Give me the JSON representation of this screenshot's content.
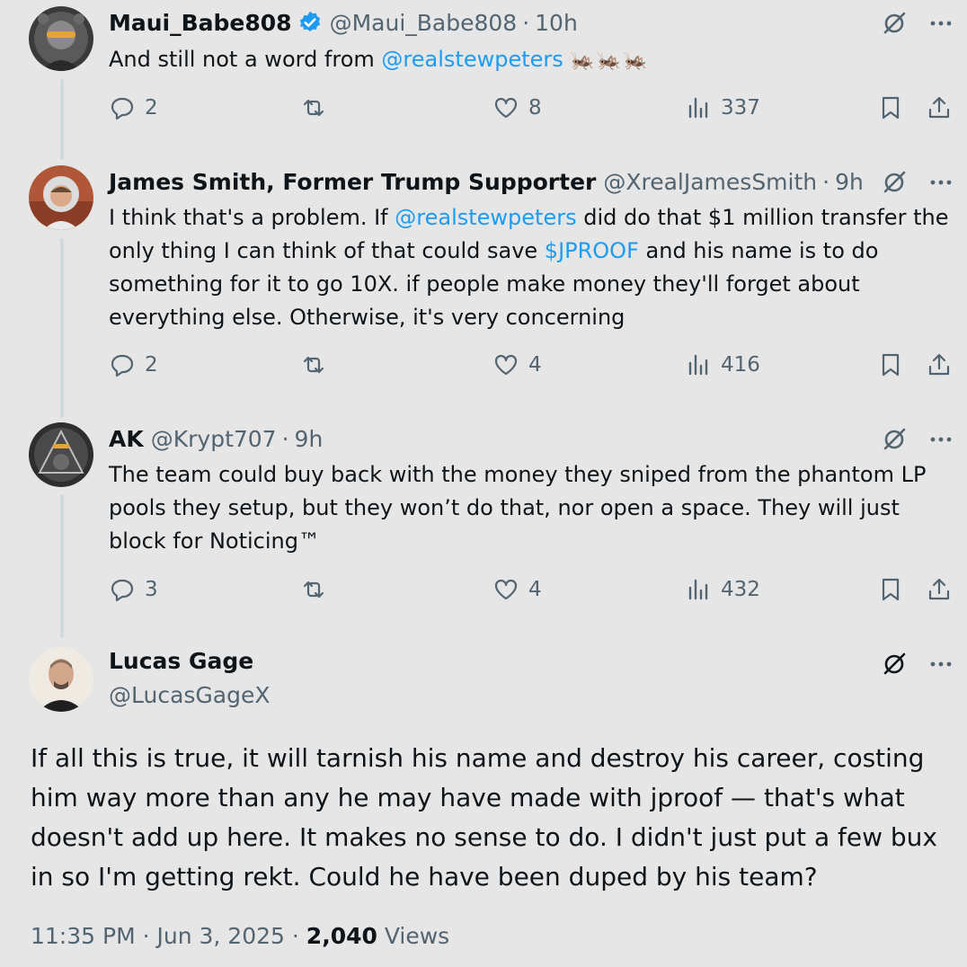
{
  "tweets": [
    {
      "name": "Maui_Babe808",
      "handle": "@Maui_Babe808",
      "sep": "·",
      "time": "10h",
      "verified": true,
      "text_pre": "And still not a word from ",
      "mention1": "@realstewpeters",
      "emoji": "🦗🦗🦗",
      "replies": "2",
      "likes": "8",
      "views": "337"
    },
    {
      "name": "James Smith, Former Trump Supporter",
      "handle": "@XrealJamesSmith",
      "sep": "·",
      "time": "9h",
      "text_a": "I think that's a problem. If ",
      "mention1": "@realstewpeters",
      "text_b": " did do that $1 million transfer the only thing I can think of that could save ",
      "cashtag": "$JPROOF",
      "text_c": " and his name is to do something for it to go 10X. if people make money they'll forget about everything else. Otherwise, it's very concerning",
      "replies": "2",
      "likes": "4",
      "views": "416"
    },
    {
      "name": "AK",
      "handle": "@Krypt707",
      "sep": "·",
      "time": "9h",
      "text": "The team could buy back with the money they sniped from the phantom LP pools they setup, but they won’t do that, nor open a space. They will just block for Noticing™",
      "replies": "3",
      "likes": "4",
      "views": "432"
    }
  ],
  "main": {
    "name": "Lucas Gage",
    "handle": "@LucasGageX",
    "text": "If all this is true, it will tarnish his name and destroy his career, costing him way more than any he may have made with jproof — that's what doesn't add up here. It makes no sense to do. I didn't just put a few bux in so I'm getting rekt. Could he have been duped by his team?",
    "time": "11:35 PM",
    "sep1": "·",
    "date": "Jun 3, 2025",
    "sep2": "·",
    "views_count": "2,040",
    "views_label": "Views"
  },
  "icons": {
    "reply": "reply-icon",
    "retweet": "retweet-icon",
    "like": "like-icon",
    "views": "views-icon",
    "bookmark": "bookmark-icon",
    "share": "share-icon",
    "grok": "grok-icon",
    "more": "more-icon",
    "verified": "verified-icon"
  },
  "colors": {
    "background": "#e6e6e6",
    "accent": "#1d9bf0",
    "muted": "#536471",
    "text": "#0f1419"
  }
}
